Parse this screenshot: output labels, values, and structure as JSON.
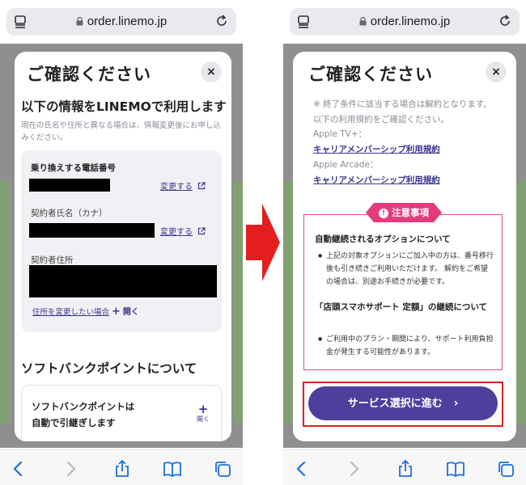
{
  "browser": {
    "url": "order.linemo.jp"
  },
  "left_modal": {
    "title": "ご確認ください",
    "close": "×",
    "section_heading": "以下の情報をLINEMOで利用します",
    "section_note": "現在の氏名や住所と異なる場合は、情報変更後にお申し込みください。",
    "phone_label": "乗り換えする電話番号",
    "change_label": "変更する",
    "name_label": "契約者氏名（カナ）",
    "address_label": "契約者住所",
    "address_change_link": "住所を変更したい場合",
    "open_label": "開く",
    "plus": "+",
    "points_heading": "ソフトバンクポイントについて",
    "points_line1": "ソフトバンクポイントは",
    "points_line2": "自動で引継ぎします",
    "points_open": "開く"
  },
  "right_modal": {
    "title": "ご確認ください",
    "close": "×",
    "note": "※ 終了条件に該当する場合は解約となります。以下の利用規約をご確認ください。",
    "apple_tv_label": "Apple TV+：",
    "apple_tv_link": "キャリアメンバーシップ利用規約",
    "apple_arcade_label": "Apple Arcade：",
    "apple_arcade_link": "キャリアメンバーシップ利用規約",
    "notice_badge": "注意事項",
    "notice_icon": "!",
    "notice_heading1": "自動継続されるオプションについて",
    "notice_item1": "上記の対象オプションにご加入中の方は、番号移行後も引き続きご利用いただけます。 解約をご希望の場合は、別途お手続きが必要です。",
    "notice_heading2": "「店頭スマホサポート 定額」の継続について",
    "notice_item2": "ご利用中のプラン・期間により、サポート利用負担金が発生する可能性があります。",
    "bullet": "●",
    "cta_label": "サービス選択に進む",
    "cta_chevron": "›"
  },
  "colors": {
    "accent_purple": "#4e3f9d",
    "link_purple": "#3a3690",
    "notice_pink": "#e53b7c",
    "highlight_red": "#e02020",
    "ios_blue": "#1a6fe0"
  },
  "icons": [
    "tabs-icon",
    "lock-icon",
    "reload-icon",
    "external-link-icon",
    "back-icon",
    "forward-icon",
    "share-icon",
    "bookmarks-icon",
    "tabs-overview-icon",
    "arrow-right-icon",
    "warning-icon",
    "chevron-right-icon"
  ]
}
